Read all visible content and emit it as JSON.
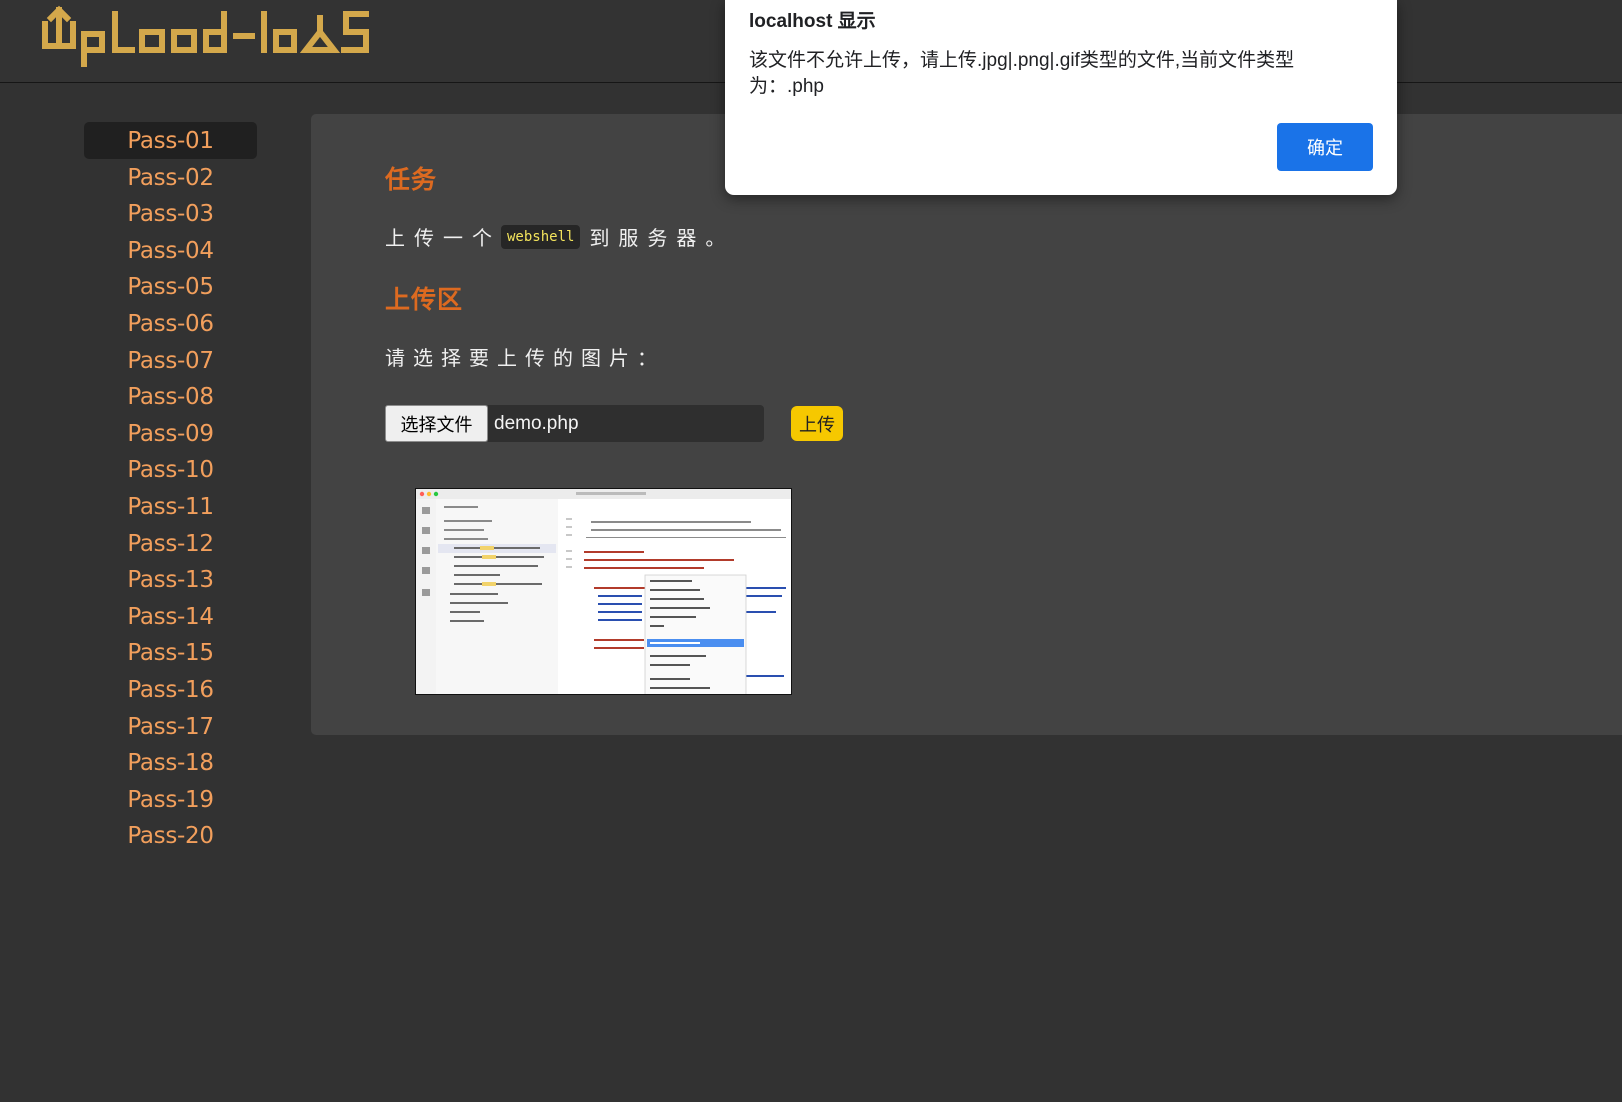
{
  "header": {
    "logo_text": "Upload-labs",
    "logo_color": "#d4a84b"
  },
  "sidebar": {
    "active_index": 0,
    "items": [
      {
        "label": "Pass-01"
      },
      {
        "label": "Pass-02"
      },
      {
        "label": "Pass-03"
      },
      {
        "label": "Pass-04"
      },
      {
        "label": "Pass-05"
      },
      {
        "label": "Pass-06"
      },
      {
        "label": "Pass-07"
      },
      {
        "label": "Pass-08"
      },
      {
        "label": "Pass-09"
      },
      {
        "label": "Pass-10"
      },
      {
        "label": "Pass-11"
      },
      {
        "label": "Pass-12"
      },
      {
        "label": "Pass-13"
      },
      {
        "label": "Pass-14"
      },
      {
        "label": "Pass-15"
      },
      {
        "label": "Pass-16"
      },
      {
        "label": "Pass-17"
      },
      {
        "label": "Pass-18"
      },
      {
        "label": "Pass-19"
      },
      {
        "label": "Pass-20"
      }
    ]
  },
  "main": {
    "task_heading": "任务",
    "task_prefix": "上传一个",
    "task_code": "webshell",
    "task_suffix": "到服务器。",
    "upload_heading": "上传区",
    "upload_prompt": "请选择要上传的图片：",
    "file_button_label": "选择文件",
    "file_name": "demo.php",
    "upload_button_label": "上传"
  },
  "dialog": {
    "title": "localhost 显示",
    "message": "该文件不允许上传，请上传.jpg|.png|.gif类型的文件,当前文件类型为：.php",
    "ok_label": "确定"
  },
  "colors": {
    "accent": "#dd6a20",
    "nav": "#f29f5c",
    "highlight": "#f3e45c",
    "button": "#f6c800",
    "dialog_button": "#1a73e8"
  }
}
